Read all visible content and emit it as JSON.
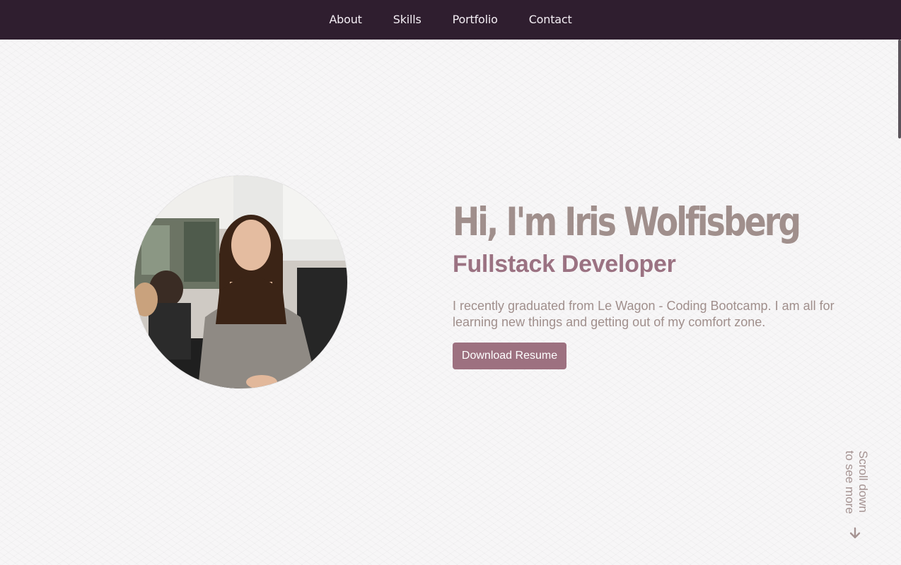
{
  "nav": {
    "items": [
      {
        "label": "About"
      },
      {
        "label": "Skills"
      },
      {
        "label": "Portfolio"
      },
      {
        "label": "Contact"
      }
    ]
  },
  "hero": {
    "title": "Hi, I'm Iris Wolfisberg",
    "subtitle": "Fullstack Developer",
    "description": "I recently graduated from Le Wagon - Coding Bootcamp. I am all for learning new things and getting out of my comfort zone.",
    "button_label": "Download Resume"
  },
  "scroll_hint": {
    "line1": "Scroll down",
    "line2": "to see more",
    "icon": "arrow-down-icon"
  },
  "colors": {
    "navbar_bg": "#2f1e2f",
    "accent": "#9d7180",
    "title": "#a08f8c"
  }
}
